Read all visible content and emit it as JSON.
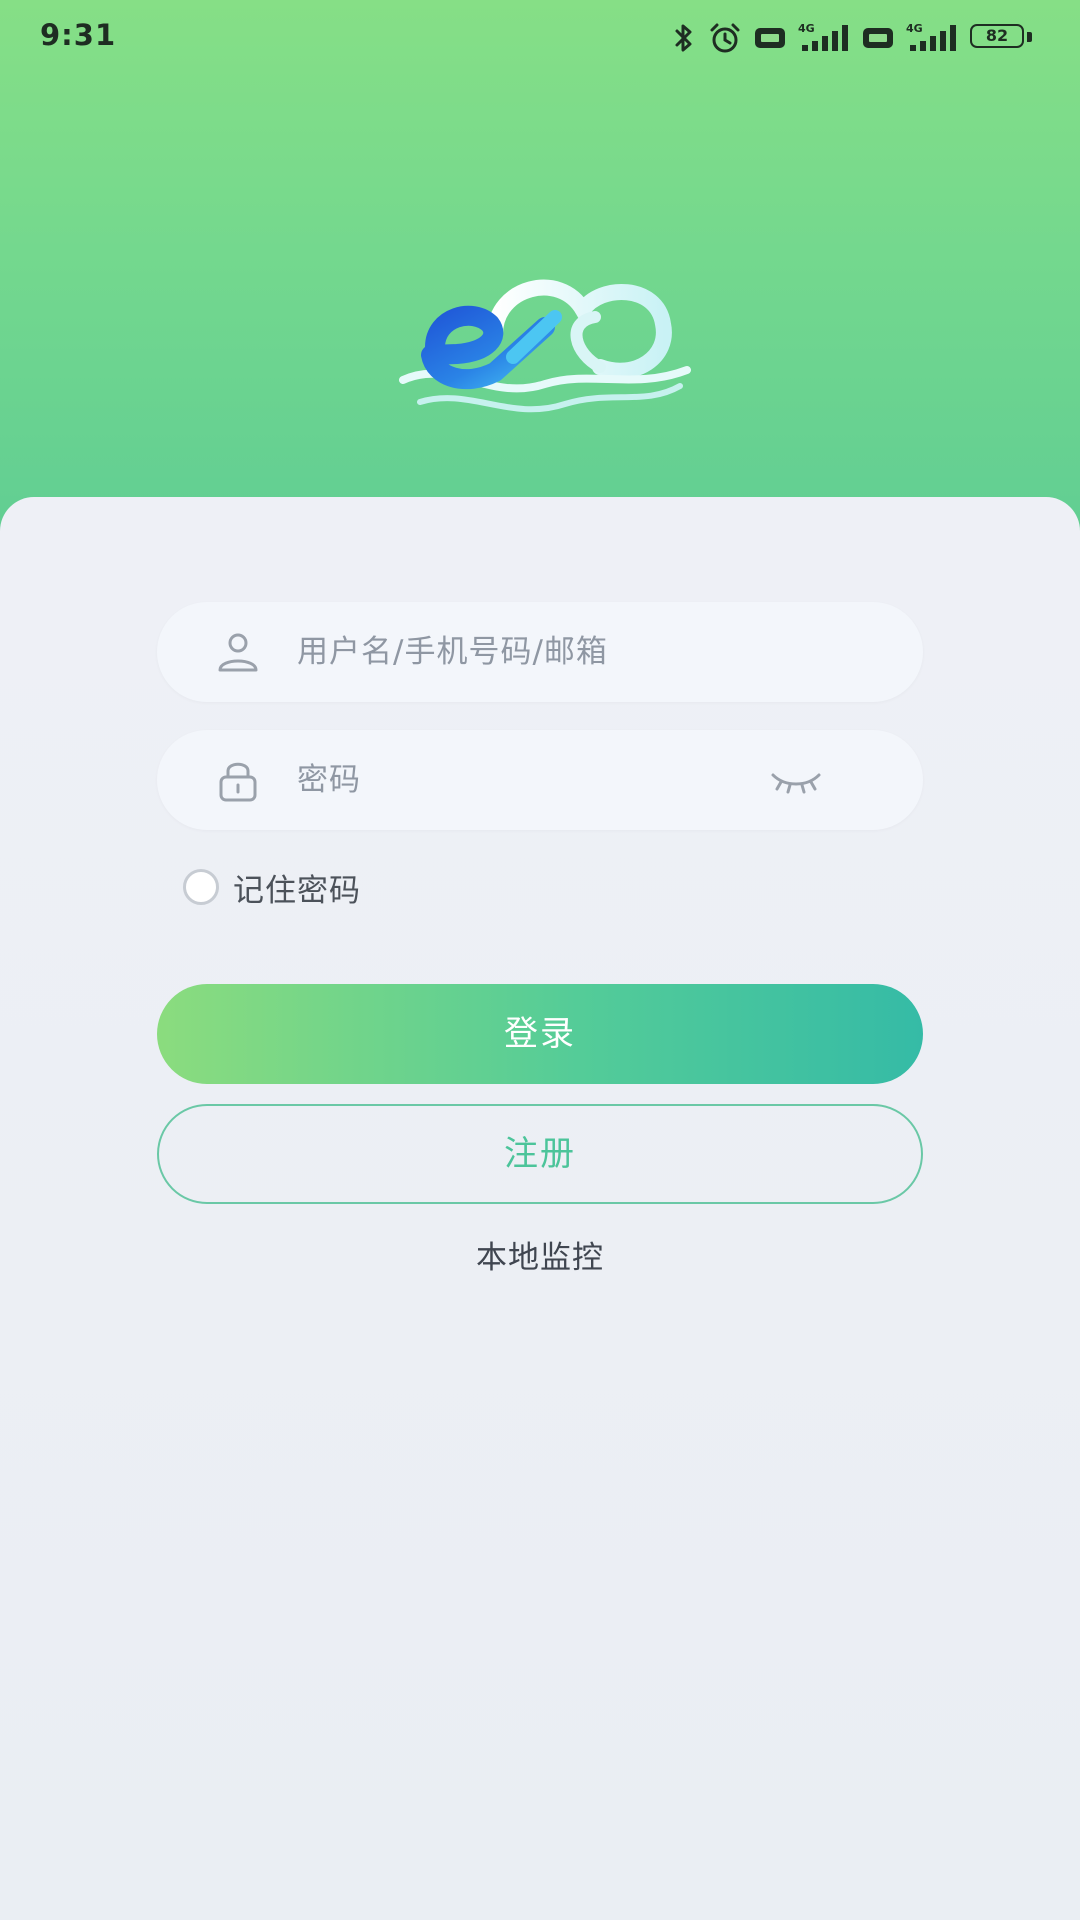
{
  "status_bar": {
    "time": "9:31",
    "battery": "82",
    "network_1": "4G",
    "network_2": "4G",
    "icons": [
      "bluetooth-icon",
      "alarm-icon",
      "hd-icon",
      "signal-icon",
      "hd-icon",
      "signal-icon",
      "battery-icon"
    ]
  },
  "logo": {
    "icon": "cloud-e-logo",
    "colors": [
      "#1f6fd8",
      "#47b3f0",
      "#d4f3f8"
    ]
  },
  "login_form": {
    "username_placeholder": "用户名/手机号码/邮箱",
    "password_placeholder": "密码",
    "remember_label": "记住密码",
    "remember_checked": false,
    "login_label": "登录",
    "register_label": "注册",
    "local_monitor_label": "本地监控"
  },
  "colors": {
    "header_top": "#86df86",
    "header_bottom": "#5fcd93",
    "accent": "#4cc49a",
    "card_bg": "#eef0f6"
  }
}
